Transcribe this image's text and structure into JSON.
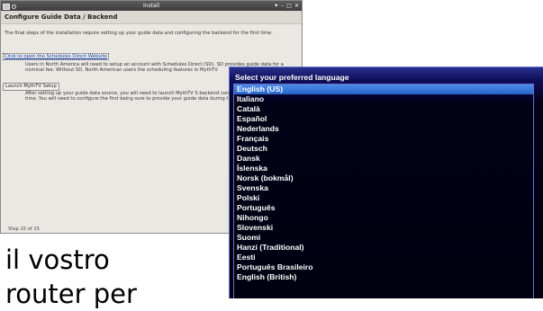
{
  "installer": {
    "window_title": "Install",
    "header": "Configure Guide Data / Backend",
    "intro": "The final steps of the installation require setting up your guide data and configuring the backend for the first time.",
    "schedules_direct_link": "Click to open the Schedules Direct Website",
    "schedules_direct_text": "Users in North America will need to setup an account with Schedules Direct (SD). SD provides guide data for a nominal fee.  Without SD, North American users the scheduling features in MythTV.",
    "launch_button": "Launch MythTV Setup",
    "mythtv_text": "After setting up your guide data source, you will need to launch MythTV S backend configuration for the first time. You will need to configure the first being sure to provide your guide data during the third.",
    "step": "Step 15 of 15",
    "window_controls": [
      "✦",
      "–",
      "□",
      "✕"
    ]
  },
  "language_selector": {
    "title": "Select your preferred language",
    "selected": "English (US)",
    "languages": [
      "English (US)",
      "Italiano",
      "Català",
      "Español",
      "Nederlands",
      "Français",
      "Deutsch",
      "Dansk",
      "Íslenska",
      "Norsk (bokmål)",
      "Svenska",
      "Polski",
      "Português",
      "Nihongo",
      "Slovenski",
      "Suomi",
      "Hanzi (Traditional)",
      "Eesti",
      "Português Brasileiro",
      "English (British)"
    ]
  },
  "caption": {
    "line1": "il vostro",
    "line2": "router per"
  },
  "colors": {
    "selection": "#3a78dc",
    "panel_background": "#000010",
    "link": "#1a47b5"
  }
}
